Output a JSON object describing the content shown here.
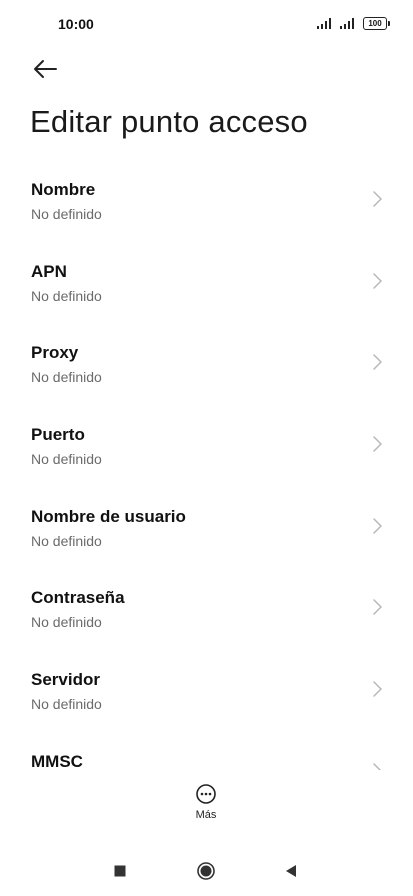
{
  "status_bar": {
    "time": "10:00",
    "battery": "100"
  },
  "header": {
    "title": "Editar punto acceso"
  },
  "fields": [
    {
      "label": "Nombre",
      "value": "No definido"
    },
    {
      "label": "APN",
      "value": "No definido"
    },
    {
      "label": "Proxy",
      "value": "No definido"
    },
    {
      "label": "Puerto",
      "value": "No definido"
    },
    {
      "label": "Nombre de usuario",
      "value": "No definido"
    },
    {
      "label": "Contraseña",
      "value": "No definido"
    },
    {
      "label": "Servidor",
      "value": "No definido"
    },
    {
      "label": "MMSC",
      "value": ""
    }
  ],
  "bottom_action": {
    "more_label": "Más"
  },
  "icons": {
    "back": "arrow-left-icon",
    "chevron": "chevron-right-icon",
    "more": "more-circle-icon",
    "nav_recent": "square-icon",
    "nav_home": "circle-icon",
    "nav_back": "triangle-left-icon"
  },
  "colors": {
    "background": "#ffffff",
    "title_text": "#111111",
    "subtitle_text": "#6b6b6b",
    "chevron": "#b8b8b8"
  }
}
